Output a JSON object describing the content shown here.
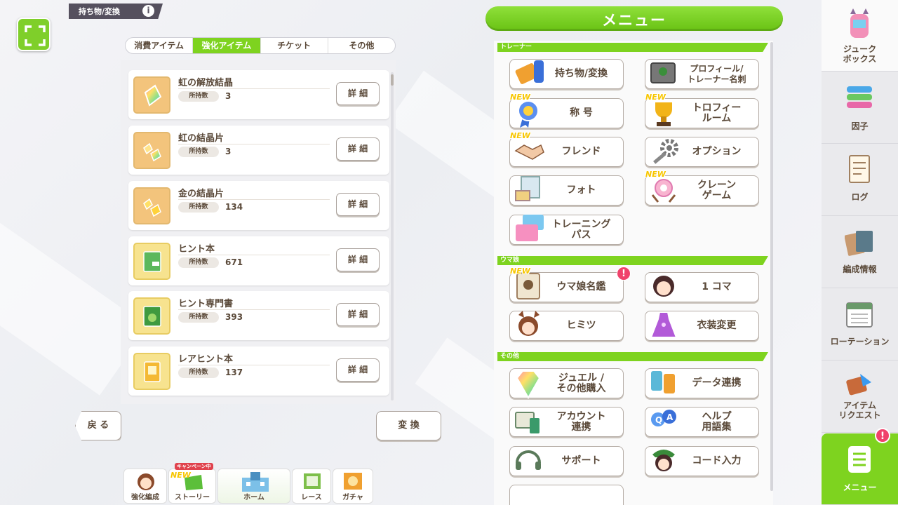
{
  "header": {
    "title": "持ち物/変換",
    "info": "i"
  },
  "tabs": [
    "消費アイテム",
    "強化アイテム",
    "チケット",
    "その他"
  ],
  "items": [
    {
      "name": "虹の解放結晶",
      "qty_label": "所持数",
      "qty": "3",
      "detail": "詳 細",
      "color": "#f3c47c",
      "icon": "rainbow-crystal-icon"
    },
    {
      "name": "虹の結晶片",
      "qty_label": "所持数",
      "qty": "3",
      "detail": "詳 細",
      "color": "#f3c47c",
      "icon": "rainbow-shard-icon"
    },
    {
      "name": "金の結晶片",
      "qty_label": "所持数",
      "qty": "134",
      "detail": "詳 細",
      "color": "#f3c47c",
      "icon": "gold-shard-icon"
    },
    {
      "name": "ヒント本",
      "qty_label": "所持数",
      "qty": "671",
      "detail": "詳 細",
      "color": "#f7e38f",
      "icon": "hint-book-icon"
    },
    {
      "name": "ヒント専門書",
      "qty_label": "所持数",
      "qty": "393",
      "detail": "詳 細",
      "color": "#f7e38f",
      "icon": "hint-expert-book-icon"
    },
    {
      "name": "レアヒント本",
      "qty_label": "所持数",
      "qty": "137",
      "detail": "詳 細",
      "color": "#f7e38f",
      "icon": "rare-hint-book-icon"
    }
  ],
  "buttons": {
    "back": "戻 る",
    "convert": "変 換"
  },
  "bottom_nav": {
    "enhance": "強化編成",
    "story": "ストーリー",
    "home": "ホーム",
    "race": "レース",
    "gacha": "ガチャ",
    "campaign": "キャンペーン中",
    "new": "NEW"
  },
  "menu": {
    "title": "メニュー",
    "sections": {
      "trainer": "トレーナー",
      "umamusume": "ウマ娘",
      "other": "その他"
    },
    "new_badge": "NEW",
    "alert": "!",
    "trainer_buttons": [
      "持ち物/変換",
      "プロフィール/\nトレーナー名刺",
      "称 号",
      "トロフィー\nルーム",
      "フレンド",
      "オプション",
      "フォト",
      "クレーン\nゲーム",
      "トレーニング\nパス"
    ],
    "uma_buttons": [
      "ウマ娘名鑑",
      "1 コマ",
      "ヒミツ",
      "衣装変更"
    ],
    "other_buttons": [
      "ジュエル /\nその他購入",
      "データ連携",
      "アカウント\n連携",
      "ヘルプ\n用語集",
      "サポート",
      "コード入力"
    ]
  },
  "sidebar": [
    "ジューク\nボックス",
    "因子",
    "ログ",
    "編成情報",
    "ローテーション",
    "アイテム\nリクエスト",
    "メニュー"
  ]
}
